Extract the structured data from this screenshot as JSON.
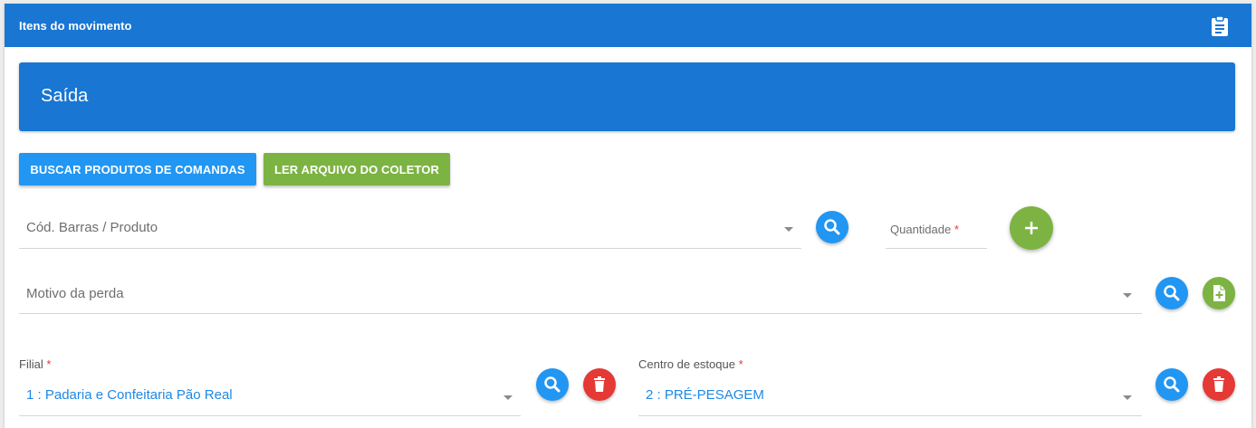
{
  "header": {
    "title": "Itens do movimento",
    "icon": "clipboard-list-icon"
  },
  "banner": {
    "title": "Saída"
  },
  "actions": {
    "buscar_label": "BUSCAR PRODUTOS DE COMANDAS",
    "ler_label": "LER ARQUIVO DO COLETOR"
  },
  "product": {
    "placeholder": "Cód. Barras / Produto",
    "search_icon": "search-icon"
  },
  "quantity": {
    "label": "Quantidade",
    "required_mark": "*",
    "add_icon": "plus-icon"
  },
  "reason": {
    "placeholder": "Motivo da perda",
    "search_icon": "search-icon",
    "new_icon": "file-plus-icon"
  },
  "filial": {
    "label": "Filial",
    "required_mark": "*",
    "value": "1 : Padaria e Confeitaria Pão Real",
    "search_icon": "search-icon",
    "delete_icon": "trash-icon"
  },
  "centro": {
    "label": "Centro de estoque",
    "required_mark": "*",
    "value": "2 : PRÉ-PESAGEM",
    "search_icon": "search-icon",
    "delete_icon": "trash-icon"
  },
  "colors": {
    "primary": "#1976d2",
    "button_blue": "#2196f3",
    "button_green": "#7cb342",
    "danger": "#e53935",
    "value_text": "#1e88e5"
  }
}
